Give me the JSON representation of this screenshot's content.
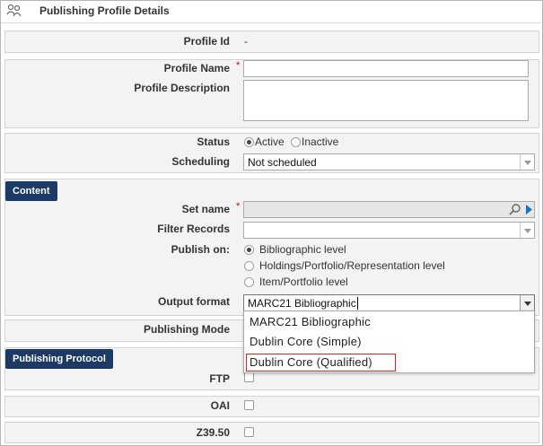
{
  "header": {
    "title": "Publishing Profile Details",
    "icon": "users-icon"
  },
  "profile_id": {
    "label": "Profile Id",
    "value": "-"
  },
  "profile_name": {
    "label": "Profile Name",
    "required_mark": "*",
    "value": ""
  },
  "profile_description": {
    "label": "Profile Description",
    "value": ""
  },
  "status": {
    "label": "Status",
    "options": [
      "Active",
      "Inactive"
    ],
    "selected": "Active"
  },
  "scheduling": {
    "label": "Scheduling",
    "value": "Not scheduled"
  },
  "content": {
    "section_label": "Content",
    "set_name": {
      "label": "Set name",
      "required_mark": "*",
      "value": "",
      "search_icon": "search-icon",
      "arrow_icon": "play-icon"
    },
    "filter_records": {
      "label": "Filter Records",
      "value": ""
    },
    "publish_on": {
      "label": "Publish on:",
      "options": [
        "Bibliographic level",
        "Holdings/Portfolio/Representation level",
        "Item/Portfolio level"
      ],
      "selected": "Bibliographic level"
    },
    "output_format": {
      "label": "Output format",
      "value": "MARC21 Bibliographic",
      "options": [
        "MARC21 Bibliographic",
        "Dublin Core (Simple)",
        "Dublin Core (Qualified)"
      ],
      "highlighted": "Dublin Core (Qualified)"
    },
    "publishing_mode": {
      "label": "Publishing Mode"
    }
  },
  "publishing_protocol": {
    "section_label": "Publishing Protocol",
    "items": [
      {
        "label": "FTP",
        "checked": false
      },
      {
        "label": "OAI",
        "checked": false
      },
      {
        "label": "Z39.50",
        "checked": false
      }
    ]
  },
  "colors": {
    "section_bg": "#1d3a66",
    "required": "#cc0000",
    "highlight_border": "#dd2222"
  }
}
